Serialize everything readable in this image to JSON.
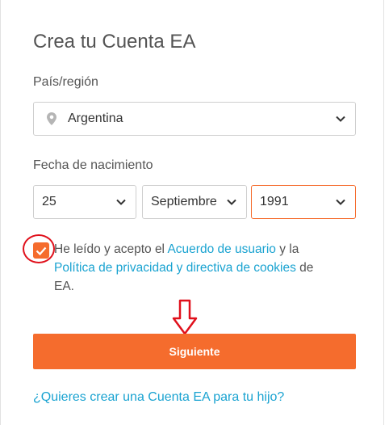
{
  "form": {
    "title": "Crea tu Cuenta EA",
    "country_label": "País/región",
    "country_value": "Argentina",
    "dob_label": "Fecha de nacimiento",
    "dob": {
      "day": "25",
      "month": "Septiembre",
      "year": "1991"
    },
    "consent": {
      "checked": true,
      "text_1": "He leído y acepto el ",
      "link_1": "Acuerdo de usuario",
      "text_2": " y la ",
      "link_2": "Política de privacidad y directiva de cookies",
      "text_3": " de EA."
    },
    "next_button": "Siguiente",
    "child_account_link": "¿Quieres crear una Cuenta EA para tu hijo?"
  },
  "colors": {
    "accent": "#f56c2d",
    "link": "#1aa3d1",
    "annotation": "#e0101b"
  },
  "icons": [
    "location-pin-icon",
    "chevron-down-icon",
    "checkmark-icon"
  ]
}
